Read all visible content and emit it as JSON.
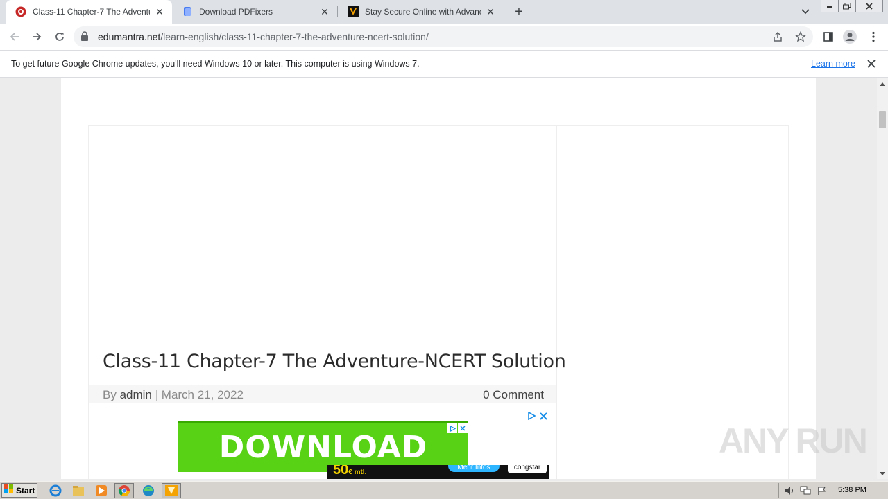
{
  "browser": {
    "tabs": [
      {
        "title": "Class-11 Chapter-7 The Adventure-NCERT Solution",
        "active": true
      },
      {
        "title": "Download PDFixers",
        "active": false
      },
      {
        "title": "Stay Secure Online with Advanced Anti",
        "active": false
      }
    ],
    "address": {
      "domain": "edumantra.net",
      "path": "/learn-english/class-11-chapter-7-the-adventure-ncert-solution/"
    }
  },
  "infobar": {
    "message": "To get future Google Chrome updates, you'll need Windows 10 or later. This computer is using Windows 7.",
    "learn_more": "Learn more"
  },
  "page": {
    "title": "Class-11 Chapter-7 The Adventure-NCERT Solution",
    "meta": {
      "by": "By",
      "author": "admin",
      "separator": "|",
      "date": "March 21, 2022",
      "comments": "0 Comment"
    },
    "ad": {
      "download_text": "DOWNLOAD",
      "price": "50",
      "price_suffix": "€ mtl.",
      "mehr": "Mehr Infos",
      "brand": "congstar"
    }
  },
  "watermark": "ANY RUN",
  "taskbar": {
    "start_label": "Start",
    "clock": "5:38 PM"
  },
  "colors": {
    "tab_strip": "#dee1e6",
    "link": "#1a73e8",
    "ad_green": "#57d214",
    "title_text": "#2b2b2b"
  }
}
